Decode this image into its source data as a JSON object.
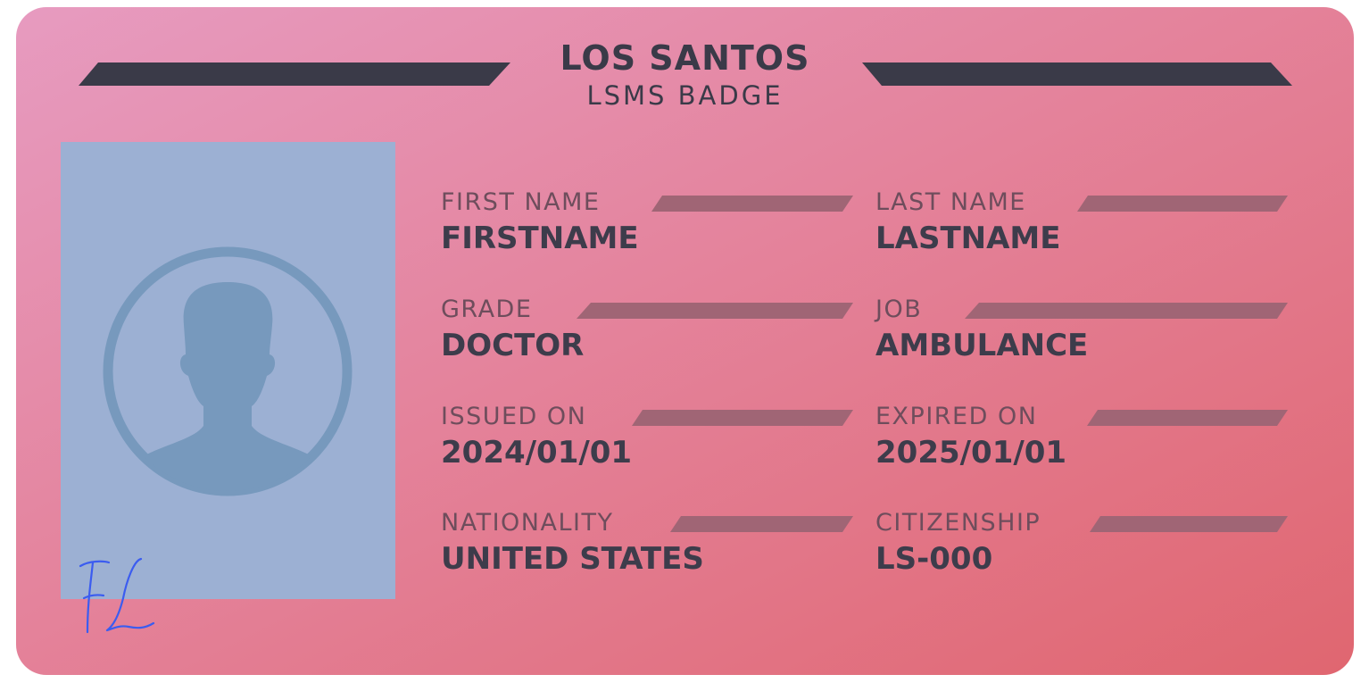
{
  "badge": {
    "title": "LOS SANTOS",
    "subtitle": "LSMS BADGE",
    "signature_initials": "FL",
    "colors": {
      "gradient_start": "#e79bc0",
      "gradient_end": "#e06670",
      "dark_bar": "#3a3a48",
      "photo_bg": "#9cb0d3",
      "avatar": "#7799bd",
      "signature_ink": "#3b5cf0"
    }
  },
  "fields": [
    {
      "label": "FIRST NAME",
      "value": "FIRSTNAME"
    },
    {
      "label": "LAST NAME",
      "value": "LASTNAME"
    },
    {
      "label": "GRADE",
      "value": "DOCTOR"
    },
    {
      "label": "JOB",
      "value": "AMBULANCE"
    },
    {
      "label": "ISSUED ON",
      "value": "2024/01/01"
    },
    {
      "label": "EXPIRED ON",
      "value": "2025/01/01"
    },
    {
      "label": "NATIONALITY",
      "value": "UNITED STATES"
    },
    {
      "label": "CITIZENSHIP",
      "value": "LS-000"
    }
  ]
}
